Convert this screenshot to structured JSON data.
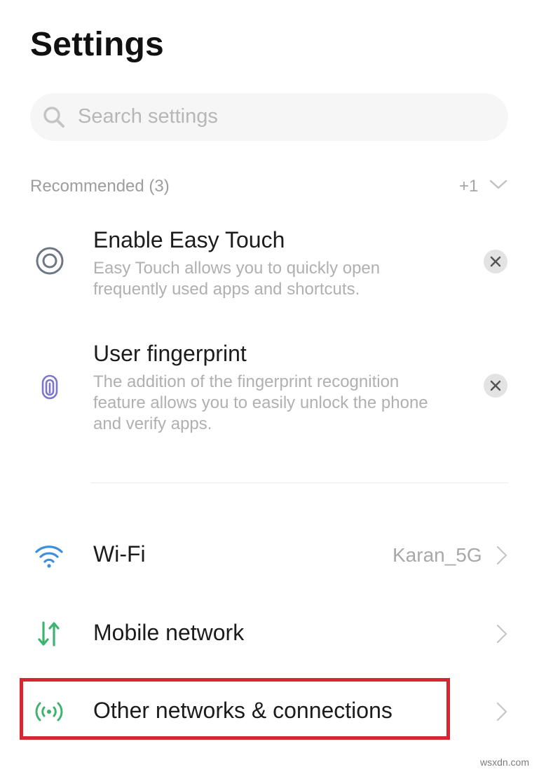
{
  "header": {
    "title": "Settings"
  },
  "search": {
    "placeholder": "Search settings",
    "icon": "search-icon"
  },
  "recommended": {
    "label": "Recommended (3)",
    "more_count": "+1",
    "items": [
      {
        "title": "Enable Easy Touch",
        "description_lines": [
          "Easy Touch allows you to quickly open",
          "frequently used apps and shortcuts."
        ],
        "icon": "easy-touch-icon"
      },
      {
        "title": "User fingerprint",
        "description_lines": [
          "The addition of the fingerprint recognition",
          "feature allows you to easily unlock the phone",
          "and verify apps."
        ],
        "icon": "fingerprint-icon"
      }
    ]
  },
  "settings_list": [
    {
      "label": "Wi-Fi",
      "value": "Karan_5G",
      "icon": "wifi-icon",
      "icon_color": "#3b8fe0"
    },
    {
      "label": "Mobile network",
      "value": "",
      "icon": "mobile-data-icon",
      "icon_color": "#3db36f"
    },
    {
      "label": "Other networks & connections",
      "value": "",
      "icon": "connections-icon",
      "icon_color": "#3db36f"
    }
  ],
  "annotation": {
    "highlight_color": "#d72630"
  },
  "watermark": "wsxdn.com"
}
